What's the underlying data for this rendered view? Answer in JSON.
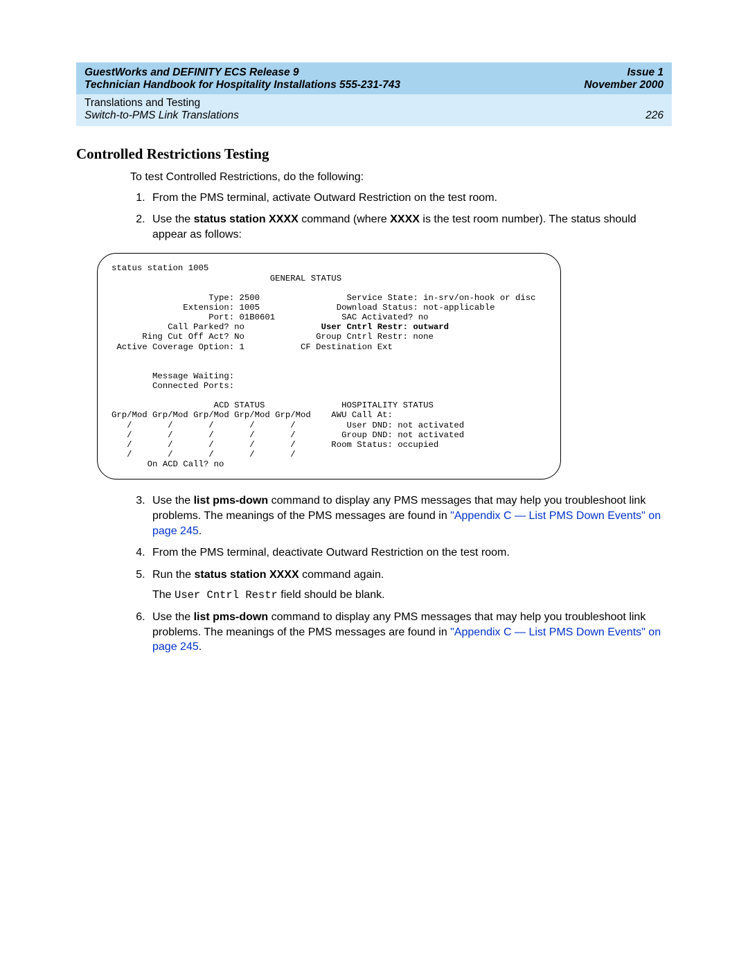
{
  "header": {
    "title_left": "GuestWorks and DEFINITY ECS Release 9",
    "title_right": "Issue 1",
    "subtitle_left": "Technician Handbook for Hospitality Installations  ",
    "docnum": "555-231-743",
    "subtitle_right": "November 2000"
  },
  "subheader": {
    "line1": "Translations and Testing",
    "line2_left": "Switch-to-PMS Link Translations",
    "page_num": "226"
  },
  "section_title": "Controlled Restrictions Testing",
  "intro": "To test Controlled Restrictions, do the following:",
  "steps_top": {
    "s1": "From the PMS terminal, activate Outward Restriction on the test room.",
    "s2_a": "Use the ",
    "s2_b": "status station XXXX",
    "s2_c": " command (where ",
    "s2_d": "XXXX",
    "s2_e": " is the test room number). The status should appear as follows:"
  },
  "terminal": {
    "l01": "status station 1005",
    "l02": "                               GENERAL STATUS",
    "l03": "",
    "l04": "                   Type: 2500                 Service State: in-srv/on-hook or disc",
    "l05": "              Extension: 1005               Download Status: not-applicable",
    "l06": "                   Port: 01B0601             SAC Activated? no",
    "l07a": "           Call Parked? no               ",
    "l07b": "User Cntrl Restr: outward",
    "l08": "      Ring Cut Off Act? No              Group Cntrl Restr: none",
    "l09": " Active Coverage Option: 1           CF Destination Ext",
    "l10": "",
    "l11": "",
    "l12": "        Message Waiting:",
    "l13": "        Connected Ports:",
    "l14": "",
    "l15": "                    ACD STATUS               HOSPITALITY STATUS",
    "l16": "Grp/Mod Grp/Mod Grp/Mod Grp/Mod Grp/Mod    AWU Call At:",
    "l17": "   /       /       /       /       /          User DND: not activated",
    "l18": "   /       /       /       /       /         Group DND: not activated",
    "l19": "   /       /       /       /       /       Room Status: occupied",
    "l20": "   /       /       /       /       /",
    "l21": "       On ACD Call? no"
  },
  "steps_bottom": {
    "s3_a": "Use the ",
    "s3_b": "list pms-down",
    "s3_c": " command to display any PMS messages that may help you troubleshoot link problems. The meanings of the PMS messages are found in ",
    "s3_link": "\"Appendix C — List PMS Down Events\" on page 245",
    "s3_end": ".",
    "s4": "From the PMS terminal, deactivate Outward Restriction on the test room.",
    "s5_a": "Run the ",
    "s5_b": "status station XXXX",
    "s5_c": " command again.",
    "s5_line2_a": "The ",
    "s5_line2_mono": "User Cntrl Restr",
    "s5_line2_b": " field should be blank.",
    "s6_a": "Use the ",
    "s6_b": "list pms-down",
    "s6_c": " command to display any PMS messages that may help you troubleshoot link problems. The meanings of the PMS messages are found in ",
    "s6_link": "\"Appendix C — List PMS Down Events\" on page 245",
    "s6_end": "."
  }
}
